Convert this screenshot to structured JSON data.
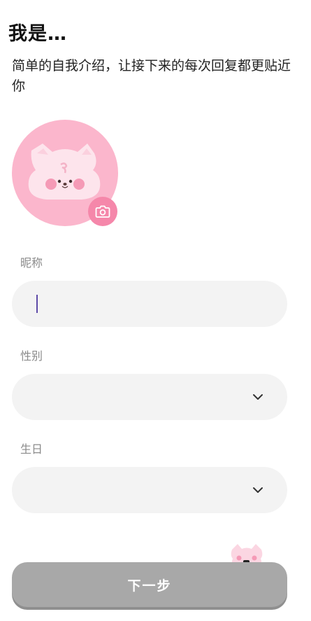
{
  "header": {
    "title": "我是…",
    "subtitle": "简单的自我介绍，让接下来的每次回复都更贴近你"
  },
  "avatar": {
    "icon": "cat-avatar",
    "edit_icon": "camera-icon",
    "bg_color": "#fbb6cc",
    "edit_color": "#f587aa"
  },
  "form": {
    "nickname": {
      "label": "昵称",
      "value": "",
      "placeholder": ""
    },
    "gender": {
      "label": "性别",
      "value": ""
    },
    "birthday": {
      "label": "生日",
      "value": ""
    }
  },
  "footer": {
    "next_label": "下一步",
    "button_color": "#a8a8a8"
  }
}
